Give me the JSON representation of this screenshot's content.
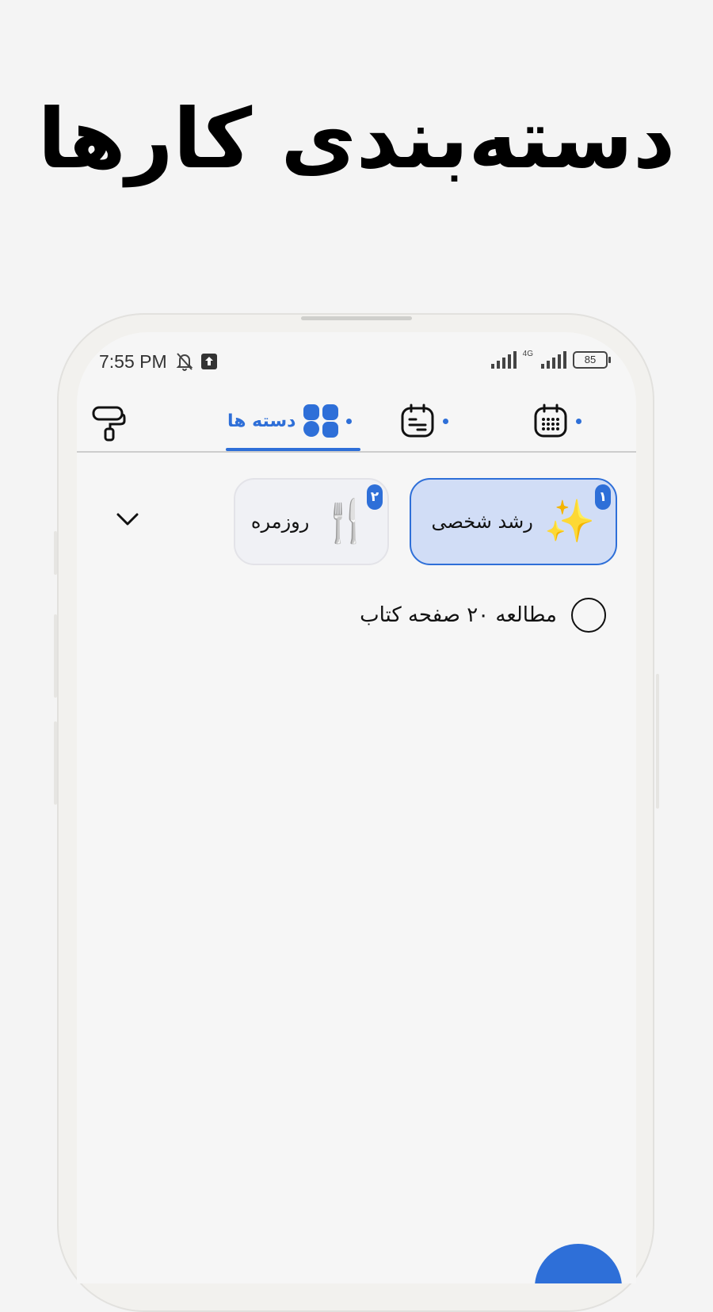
{
  "headline": "دسته‌بندی کارها",
  "status": {
    "time": "7:55 PM",
    "network": "4G",
    "battery": "85"
  },
  "tabs": [
    {
      "label": "دسته ها",
      "icon": "categories-icon",
      "active": true
    },
    {
      "label": "",
      "icon": "agenda-icon",
      "active": false
    },
    {
      "label": "",
      "icon": "calendar-icon",
      "active": false
    }
  ],
  "categories": [
    {
      "label": "رشد شخصی",
      "badge": "۱",
      "emoji": "✨",
      "selected": true
    },
    {
      "label": "روزمره",
      "badge": "۲",
      "emoji": "🍴",
      "selected": false
    }
  ],
  "tasks": [
    {
      "label": "مطالعه ۲۰ صفحه کتاب",
      "done": false
    }
  ],
  "colors": {
    "accent": "#2e6fd8",
    "chip_selected_bg": "#d1ddf6",
    "background": "#f6f6f6"
  }
}
